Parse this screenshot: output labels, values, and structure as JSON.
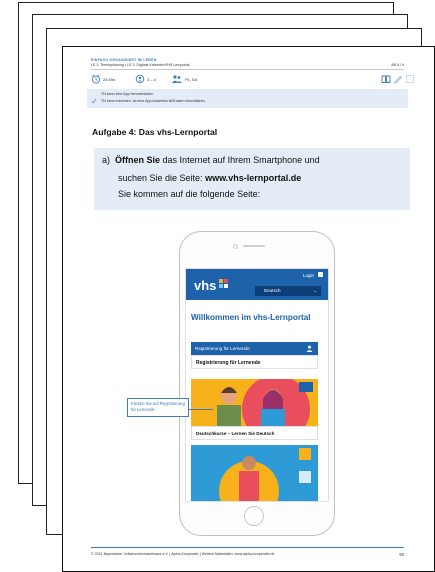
{
  "header": {
    "category": "EINFACH ORGANISIERT IM LEBEN",
    "unit": "LE 1: Terminplanung • LE 3: Digitale Kalender/VHS Lernportal",
    "sheet_number": "AB 5 / 9"
  },
  "meta": {
    "duration": "25 Min.",
    "group": "3 – 4",
    "level": "PL, EA"
  },
  "goals": [
    "TN kann eine App herunterladen.",
    "TN kann erkennen, ob eine App kostenlos ist/Kosten einschätzen."
  ],
  "task": {
    "title": "Aufgabe 4: Das vhs-Lernportal",
    "letter": "a)",
    "bold_open": "Öffnen Sie",
    "text_1": " das Internet auf Ihrem Smartphone und",
    "text_2": "suchen Sie die Seite: ",
    "url": "www.vhs-lernportal.de",
    "text_3": "Sie kommen auf die folgende Seite:"
  },
  "phone_screen": {
    "logo": "vhs",
    "login": "Login",
    "language": "Deutsch",
    "welcome": "Willkommen im vhs-Lernportal",
    "register_header": "Registrierung für Lernende",
    "register_card": "Registrierung für Lernende",
    "german_course": "Deutschkurse – Lernen Sie Deutsch"
  },
  "callout": "Klicken Sie auf Registrierung für Lernende",
  "footer": {
    "text": "© 2021 Bayerischer Volkshochschulverband e.V. | Alpha-Kooperativ | Weitere Materialien: www.alpha-kooperativ.de",
    "page_number": "50"
  },
  "colors": {
    "accent": "#3c7ac1",
    "vhs_blue": "#1d62aa",
    "box_bg": "#e3ecf7"
  }
}
